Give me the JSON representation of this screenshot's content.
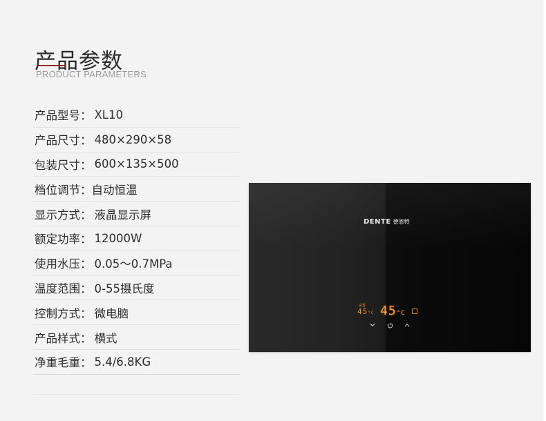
{
  "header": {
    "title": "产品参数",
    "subtitle": "PRODUCT PARAMETERS",
    "accent_color": "#8a2e26"
  },
  "params": [
    {
      "label": "产品型号：",
      "value": "XL10"
    },
    {
      "label": "产品尺寸：",
      "value": "480×290×58"
    },
    {
      "label": "包装尺寸：",
      "value": "600×135×500"
    },
    {
      "label": "档位调节：",
      "value": "自动恒温"
    },
    {
      "label": "显示方式：",
      "value": "液晶显示屏"
    },
    {
      "label": "额定功率：",
      "value": "12000W"
    },
    {
      "label": "使用水压：",
      "value": "0.05〜0.7MPa"
    },
    {
      "label": "温度范围：",
      "value": "0-55摄氏度"
    },
    {
      "label": "控制方式：",
      "value": "微电脑"
    },
    {
      "label": "产品样式：",
      "value": "横式"
    },
    {
      "label": "净重毛重：",
      "value": "5.4/6.8KG"
    }
  ],
  "product": {
    "brand_en": "DENTE",
    "brand_zh": "德恩特",
    "display": {
      "small_label": "设置",
      "small_temp": "45",
      "big_temp": "45",
      "unit": "°C",
      "digit_color": "#ffa33a"
    },
    "controls": [
      "chevron-down-icon",
      "power-icon",
      "chevron-up-icon"
    ]
  }
}
